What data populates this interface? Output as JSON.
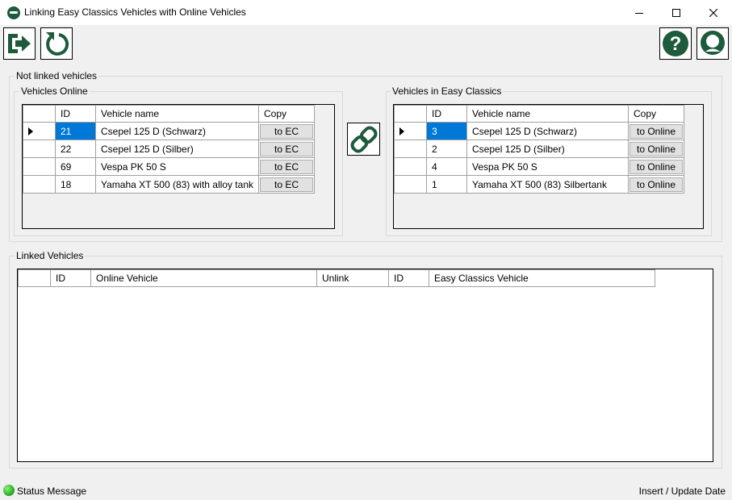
{
  "window": {
    "title": "Linking Easy Classics Vehicles with Online Vehicles",
    "minimize_glyph": "—",
    "maximize_glyph": "☐",
    "close_glyph": "✕"
  },
  "toolbar": {
    "exit_icon": "exit-icon",
    "refresh_icon": "refresh-icon",
    "help_icon": "help-icon",
    "support_icon": "support-headset-icon"
  },
  "not_linked": {
    "label": "Not linked vehicles",
    "online": {
      "label": "Vehicles Online",
      "columns": [
        "ID",
        "Vehicle name",
        "Copy"
      ],
      "rows": [
        {
          "id": "21",
          "name": "Csepel 125 D (Schwarz)",
          "copy": "to EC"
        },
        {
          "id": "22",
          "name": "Csepel 125 D (Silber)",
          "copy": "to EC"
        },
        {
          "id": "69",
          "name": "Vespa PK 50 S",
          "copy": "to EC"
        },
        {
          "id": "18",
          "name": "Yamaha XT 500 (83) with alloy tank",
          "copy": "to EC"
        }
      ]
    },
    "easy_classics": {
      "label": "Vehicles in Easy Classics",
      "columns": [
        "ID",
        "Vehicle name",
        "Copy"
      ],
      "rows": [
        {
          "id": "3",
          "name": "Csepel 125 D (Schwarz)",
          "copy": "to Online"
        },
        {
          "id": "2",
          "name": "Csepel 125 D (Silber)",
          "copy": "to Online"
        },
        {
          "id": "4",
          "name": "Vespa PK 50 S",
          "copy": "to Online"
        },
        {
          "id": "1",
          "name": "Yamaha XT 500 (83) Silbertank",
          "copy": "to Online"
        }
      ]
    },
    "link_icon": "chain-link-icon"
  },
  "linked": {
    "label": "Linked Vehicles",
    "columns": [
      "ID",
      "Online Vehicle",
      "Unlink",
      "ID",
      "Easy Classics Vehicle"
    ]
  },
  "status": {
    "message": "Status Message",
    "right": "Insert / Update Date"
  },
  "colors": {
    "brand_green": "#1e5a3c",
    "selection_blue": "#0078d7"
  }
}
